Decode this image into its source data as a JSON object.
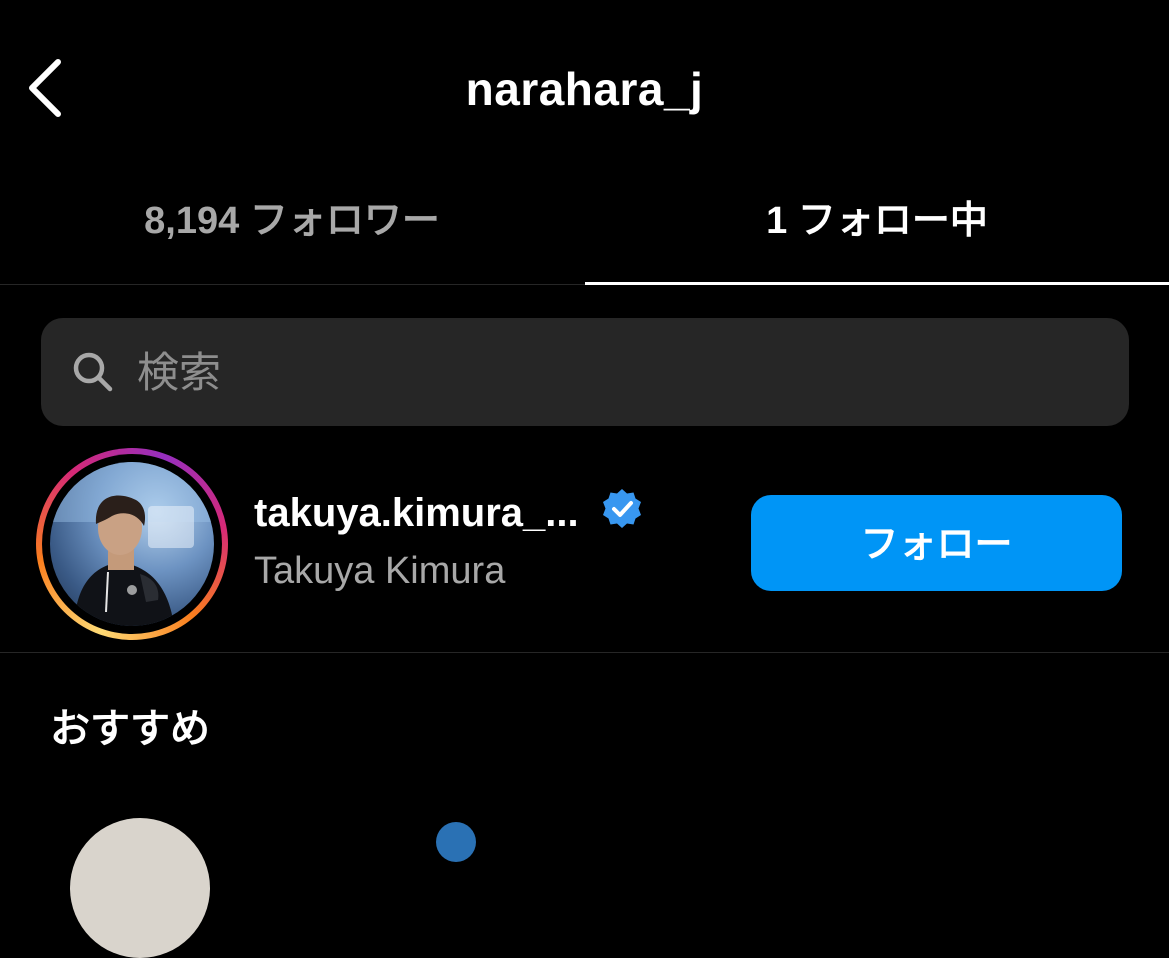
{
  "header": {
    "title": "narahara_j",
    "back_icon": "chevron-left-icon"
  },
  "tabs": [
    {
      "label": "8,194 フォロワー",
      "active": false
    },
    {
      "label": "1 フォロー中",
      "active": true
    }
  ],
  "search": {
    "placeholder": "検索",
    "icon": "search-icon"
  },
  "following": [
    {
      "username": "takuya.kimura_...",
      "full_name": "Takuya Kimura",
      "verified": true,
      "has_story": true,
      "follow_button_label": "フォロー"
    }
  ],
  "suggestions": {
    "title": "おすすめ"
  },
  "colors": {
    "background": "#000000",
    "follow_button": "#0095f6",
    "verified_badge": "#3897f0",
    "search_bg": "#262626",
    "secondary_text": "#a8a8a8"
  }
}
